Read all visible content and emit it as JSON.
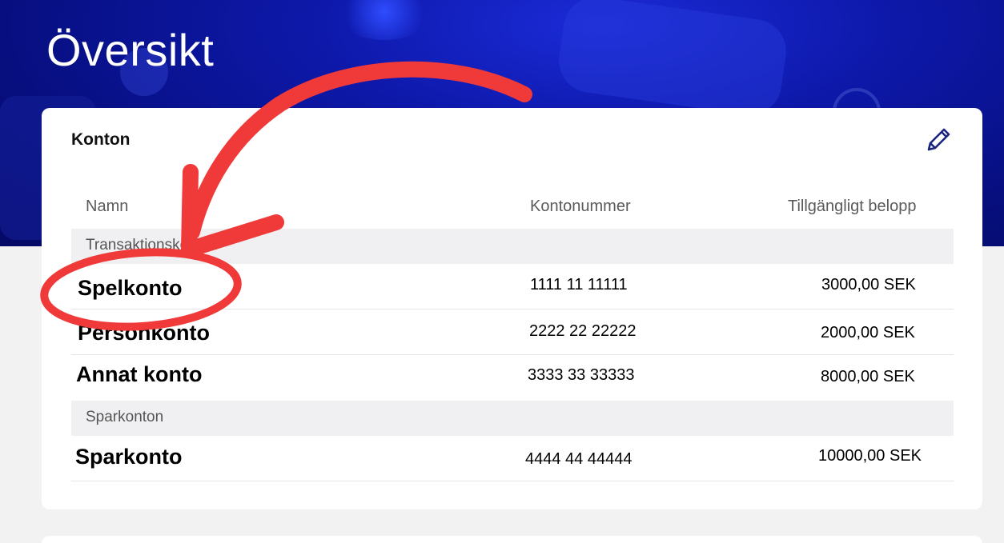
{
  "page": {
    "title": "Översikt"
  },
  "accounts_card": {
    "title": "Konton",
    "edit_icon": "pencil-icon",
    "columns": [
      "Namn",
      "Kontonummer",
      "Tillgängligt belopp"
    ],
    "groups": [
      {
        "label": "Transaktionskonton",
        "rows": [
          {
            "name": "Spelkonto",
            "number": "1111 11 11111",
            "amount": "3000,00 SEK"
          },
          {
            "name": "Personkonto",
            "number": "2222 22 22222",
            "amount": "2000,00 SEK"
          },
          {
            "name": "Annat konto",
            "number": "3333 33 33333",
            "amount": "8000,00 SEK"
          }
        ]
      },
      {
        "label": "Sparkonton",
        "rows": [
          {
            "name": "Sparkonto",
            "number": "4444 44 44444",
            "amount": "10000,00 SEK"
          }
        ]
      }
    ]
  },
  "annotation": {
    "color": "#f03a3a"
  },
  "colors": {
    "hero": "#0a16a0",
    "edit_icon": "#1a237e"
  }
}
